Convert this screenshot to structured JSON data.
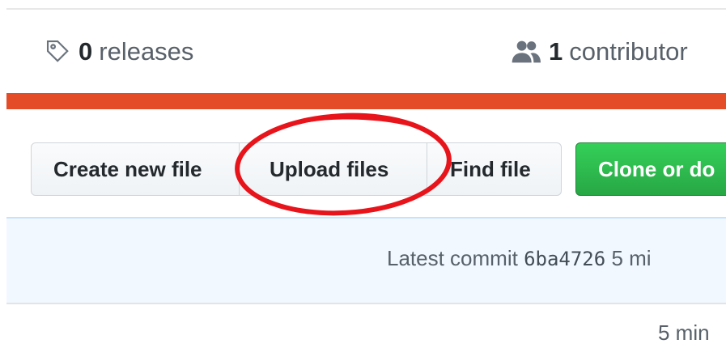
{
  "summary": {
    "releases": {
      "count": "0",
      "label": "releases",
      "icon": "tag-icon"
    },
    "contributors": {
      "count": "1",
      "label": "contributor",
      "icon": "people-icon"
    }
  },
  "language_bar": {
    "color": "#e34c26"
  },
  "toolbar": {
    "create_label": "Create new file",
    "upload_label": "Upload files",
    "find_label": "Find file",
    "clone_label": "Clone or do"
  },
  "commit": {
    "prefix": "Latest commit",
    "sha": "6ba4726",
    "age": "5 mi"
  },
  "file_row": {
    "age": "5 min"
  },
  "annotation": {
    "color": "#e8141b"
  }
}
